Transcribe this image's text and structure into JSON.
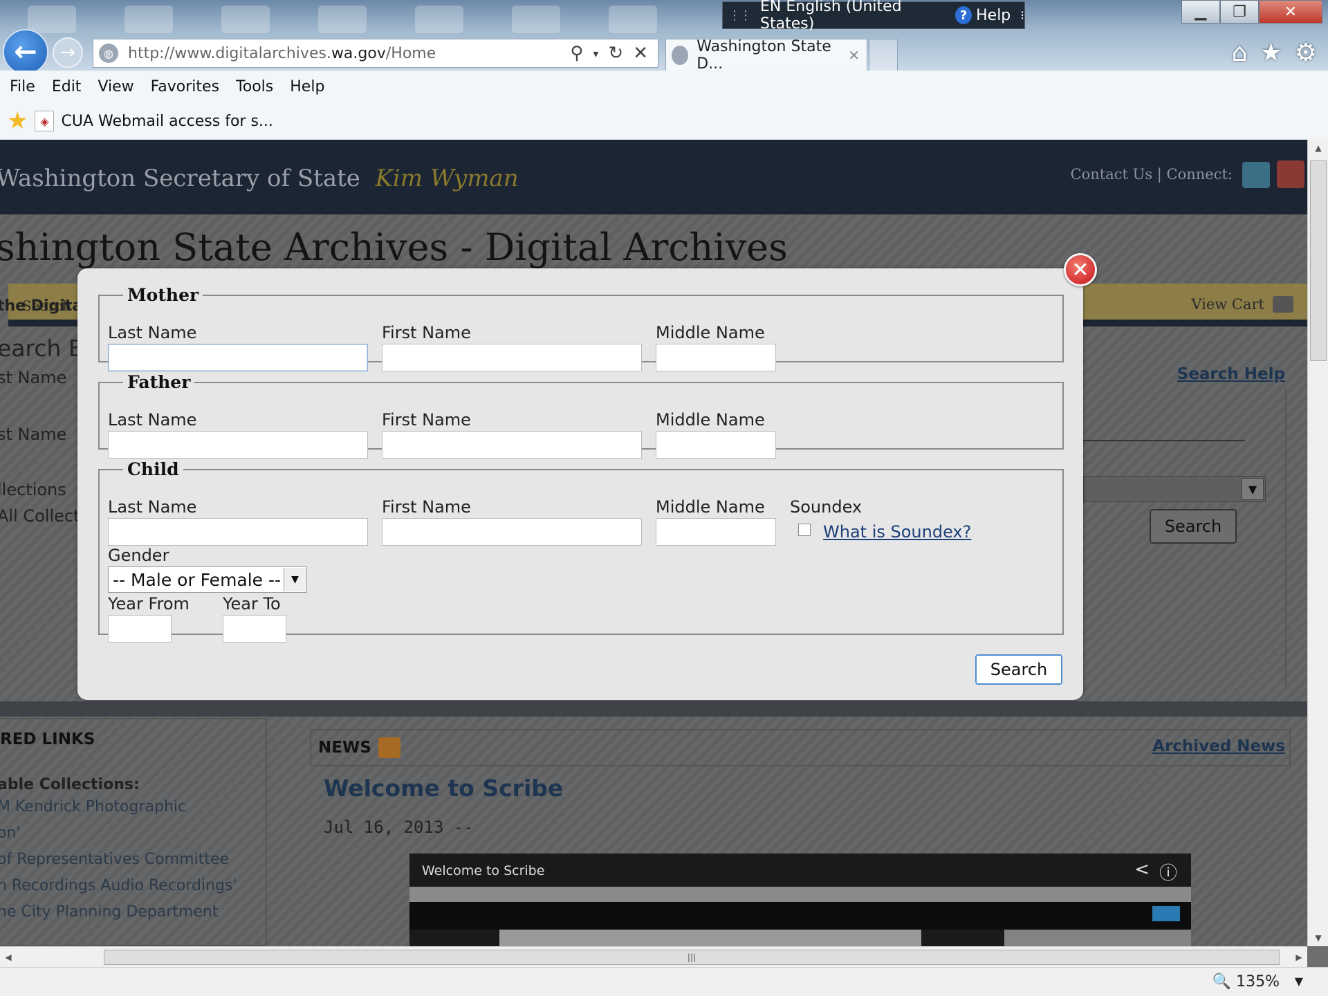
{
  "browser": {
    "language_bar": "EN English (United States)",
    "language_help": "Help",
    "address": {
      "prefix": "http://www.digitalarchives.",
      "domain": "wa.gov",
      "path": "/Home"
    },
    "tab_title": "Washington State D...",
    "menu": [
      "File",
      "Edit",
      "View",
      "Favorites",
      "Tools",
      "Help"
    ],
    "favorites": {
      "item": "CUA Webmail access for s..."
    },
    "zoom": "135%"
  },
  "site": {
    "header_title": "Washington Secretary of State",
    "header_name": "Kim Wyman",
    "contact": "Contact Us | Connect:",
    "page_title": "shington State Archives - Digital Archives",
    "nav_search": "Search",
    "view_cart": "View Cart",
    "search_help": "Search Help",
    "left_fragments": [
      "the Digital",
      "earch B",
      "st Name",
      "st Name",
      "llections",
      "All Collecti"
    ],
    "background_search_button": "Search",
    "links_heading": "RED LINKS",
    "links": [
      "able Collections:",
      "M Kendrick Photographic",
      "on'",
      "of Representatives Committee",
      "n Recordings Audio Recordings'",
      "ne City Planning Department"
    ],
    "news_heading": "NEWS",
    "archived_news": "Archived News",
    "news_title": "Welcome to Scribe",
    "news_date": "Jul 16, 2013 --",
    "video_title": "Welcome to Scribe"
  },
  "modal": {
    "mother": {
      "legend": "Mother",
      "last": "Last Name",
      "first": "First Name",
      "middle": "Middle Name"
    },
    "father": {
      "legend": "Father",
      "last": "Last Name",
      "first": "First Name",
      "middle": "Middle Name"
    },
    "child": {
      "legend": "Child",
      "last": "Last Name",
      "first": "First Name",
      "middle": "Middle Name",
      "soundex": "Soundex",
      "soundex_link": "What is Soundex?",
      "gender_label": "Gender",
      "gender_value": "-- Male or Female --",
      "year_from": "Year From",
      "year_to": "Year To"
    },
    "search_button": "Search"
  }
}
